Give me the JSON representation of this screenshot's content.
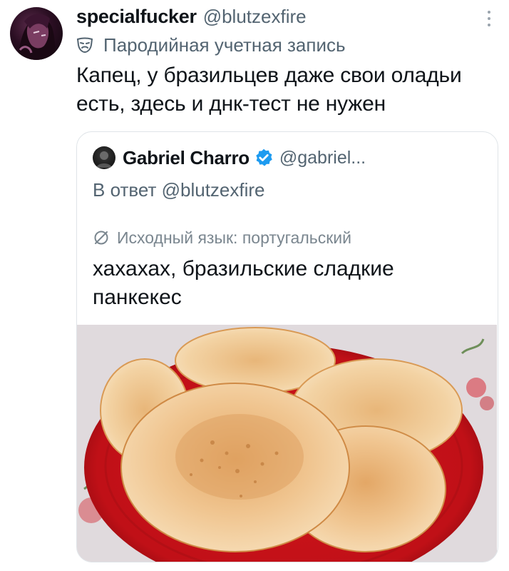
{
  "tweet": {
    "display_name": "specialfucker",
    "handle": "@blutzexfire",
    "label": "Пародийная учетная запись",
    "text_lines": [
      "Капец, у бразильцев даже свои оладьи",
      "есть, здесь и днк-тест не нужен"
    ],
    "icons": {
      "avatar": "avatar-image",
      "more": "more-options-icon",
      "label": "parody-mask-icon"
    }
  },
  "quoted_tweet": {
    "display_name": "Gabriel Charro",
    "handle": "@gabriel...",
    "reply_to": "В ответ @blutzexfire",
    "translation_note": "Исходный язык: португальский",
    "text_lines": [
      "хахахах, бразильские сладкие",
      "панкекес"
    ],
    "image_subject": "pancakes on red plate",
    "icons": {
      "verified": "verified-badge-icon",
      "translate": "translate-icon"
    }
  },
  "colors": {
    "text": "#0f1419",
    "secondary": "#536471",
    "verified": "#1d9bf0",
    "border": "#dfe4e8",
    "plate": "#c8151b"
  }
}
